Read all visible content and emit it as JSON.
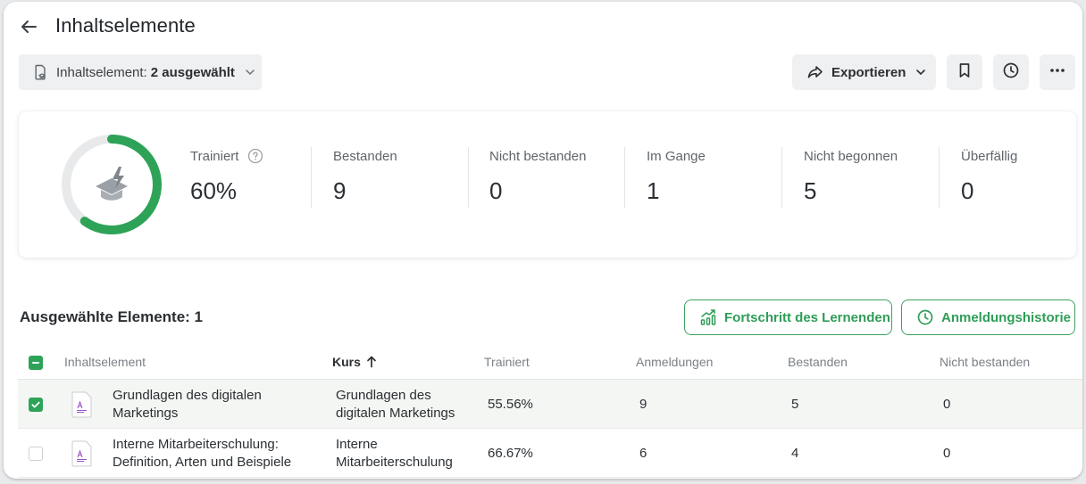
{
  "header": {
    "title": "Inhaltselemente"
  },
  "toolbar": {
    "filter_prefix": "Inhaltselement:",
    "filter_value": "2 ausgewählt",
    "export_label": "Exportieren"
  },
  "stats": {
    "progress_fraction": 0.6,
    "items": [
      {
        "label": "Trainiert",
        "value": "60%"
      },
      {
        "label": "Bestanden",
        "value": "9"
      },
      {
        "label": "Nicht bestanden",
        "value": "0"
      },
      {
        "label": "Im Gange",
        "value": "1"
      },
      {
        "label": "Nicht begonnen",
        "value": "5"
      },
      {
        "label": "Überfällig",
        "value": "0"
      }
    ]
  },
  "section": {
    "title": "Ausgewählte Elemente: 1",
    "progress_button": "Fortschritt des Lernenden",
    "history_button": "Anmeldungshistorie"
  },
  "table": {
    "columns": [
      "Inhaltselement",
      "Kurs",
      "Trainiert",
      "Anmeldungen",
      "Bestanden",
      "Nicht bestanden"
    ],
    "rows": [
      {
        "selected": true,
        "item_line1": "Grundlagen des digitalen",
        "item_line2": "Marketings",
        "course_line1": "Grundlagen des",
        "course_line2": "digitalen Marketings",
        "trained": "55.56%",
        "enrollments": "9",
        "passed": "5",
        "failed": "0"
      },
      {
        "selected": false,
        "item_line1": "Interne Mitarbeiterschulung:",
        "item_line2": "Definition, Arten und Beispiele",
        "course_line1": "Interne",
        "course_line2": "Mitarbeiterschulung",
        "trained": "66.67%",
        "enrollments": "6",
        "passed": "4",
        "failed": "0"
      }
    ]
  },
  "colors": {
    "accent": "#2ea358",
    "track": "#e8e9eb"
  }
}
